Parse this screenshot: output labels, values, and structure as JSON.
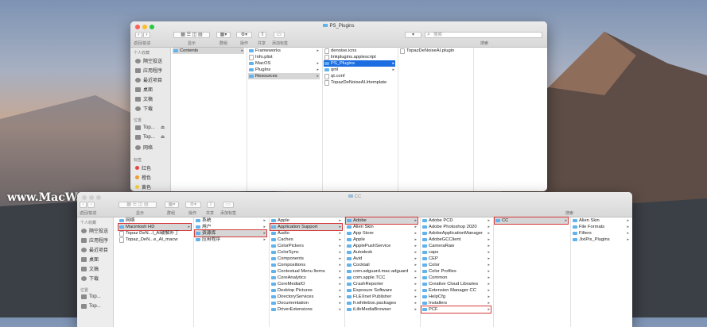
{
  "watermark": "www.MacW.com",
  "win1": {
    "title": "PS_Plugins",
    "toolbar": {
      "back": "返回/前进",
      "view": "显示",
      "group": "群组",
      "action": "操作",
      "share": "共享",
      "tags": "添加标签",
      "search_label": "搜索",
      "search_placeholder": "搜索"
    },
    "sidebar": {
      "fav_header": "个人收藏",
      "favorites": [
        {
          "label": "隔空投送",
          "icon": "airdrop-icon"
        },
        {
          "label": "应用程序",
          "icon": "applications-icon"
        },
        {
          "label": "最近项目",
          "icon": "recents-icon"
        },
        {
          "label": "桌面",
          "icon": "desktop-icon"
        },
        {
          "label": "文稿",
          "icon": "documents-icon"
        },
        {
          "label": "下载",
          "icon": "downloads-icon"
        }
      ],
      "loc_header": "位置",
      "locations": [
        {
          "label": "Top..."
        },
        {
          "label": "Top..."
        },
        {
          "label": "网络"
        }
      ],
      "tags_header": "标签",
      "tags": [
        {
          "label": "红色",
          "color": "#e8463f"
        },
        {
          "label": "橙色",
          "color": "#f29a2e"
        },
        {
          "label": "黄色",
          "color": "#f5d03c"
        }
      ]
    },
    "columns": [
      [
        "Contents"
      ],
      [
        "Frameworks",
        "Info.plist",
        "MacOS",
        "PlugIns",
        "Resources"
      ],
      [
        "denoise.icns",
        "linkplugins.applescript",
        "PS_Plugins",
        "qml",
        "qt.conf",
        "TopazDeNoiseAI.lrtemplate"
      ],
      [
        "TopazDeNoiseAI.plugin"
      ]
    ]
  },
  "win2": {
    "title": "CC",
    "toolbar": {
      "back": "返回/前进",
      "view": "显示",
      "group": "群组",
      "action": "操作",
      "share": "共享",
      "tags": "添加标签",
      "search_label": "搜索"
    },
    "sidebar": {
      "fav_header": "个人收藏",
      "favorites": [
        {
          "label": "隔空投送"
        },
        {
          "label": "应用程序"
        },
        {
          "label": "最近项目"
        },
        {
          "label": "桌面"
        },
        {
          "label": "文稿"
        },
        {
          "label": "下载"
        }
      ],
      "loc_header": "位置",
      "locations": [
        {
          "label": "Top..."
        },
        {
          "label": "Top..."
        }
      ]
    },
    "columns": [
      [
        "网络",
        "Macintosh HD",
        "Topaz DeN...I_AI破解补丁",
        "Topaz_DeN...e_AI_macw"
      ],
      [
        "系统",
        "用户",
        "资源库",
        "应用程序"
      ],
      [
        "Apple",
        "Application Support",
        "Audio",
        "Caches",
        "ColorPickers",
        "ColorSync",
        "Components",
        "Compositions",
        "Contextual Menu Items",
        "CoreAnalytics",
        "CoreMediaIO",
        "Desktop Pictures",
        "DirectoryServices",
        "Documentation",
        "DriverExtensions"
      ],
      [
        "Adobe",
        "Alien Skin",
        "App Store",
        "Apple",
        "ApplePushService",
        "Autodesk",
        "Avid",
        "Cocktail",
        "com.adguard.mac.adguard",
        "com.apple.TCC",
        "CrashReporter",
        "Exposure Software",
        "FLEXnet Publisher",
        "fr.whitebox.packages",
        "iLifeMediaBrowser"
      ],
      [
        "Adobe PCD",
        "Adobe Photoshop 2020",
        "AdobeApplicationManager",
        "AdobeGCClient",
        "CameraRaw",
        "caps",
        "CEP",
        "Color",
        "Color Profiles",
        "Common",
        "Creative Cloud Libraries",
        "Extension Manager CC",
        "HelpCfg",
        "Installers",
        "PCF"
      ],
      [
        "CC"
      ],
      [
        "Alien Skin",
        "File Formats",
        "Filters",
        "JixiPix_Plugins"
      ]
    ]
  }
}
